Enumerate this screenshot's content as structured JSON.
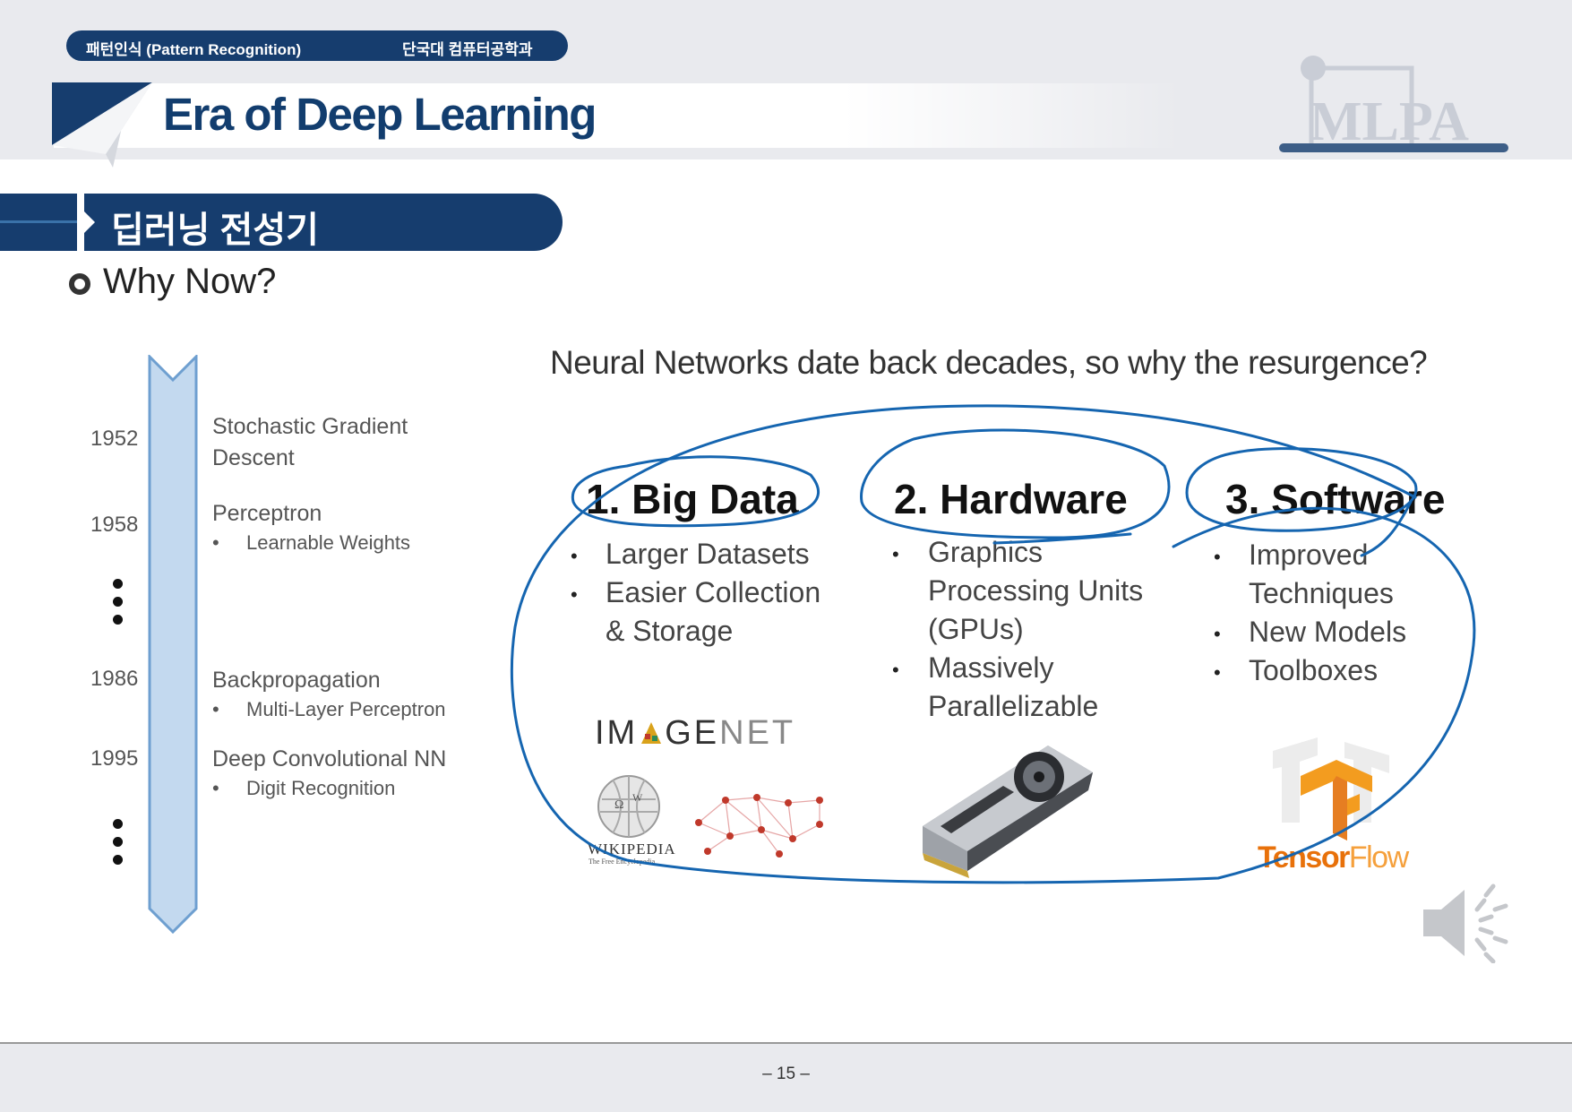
{
  "header": {
    "course": "패턴인식 (Pattern Recognition)",
    "department": "단국대 컴퓨터공학과",
    "title": "Era of Deep Learning",
    "logo_text": "MLPA"
  },
  "section": {
    "banner": "딥러닝 전성기",
    "bullet": "Why Now?"
  },
  "timeline": {
    "entries": [
      {
        "year": "1952",
        "title_line1": "Stochastic Gradient",
        "title_line2": "Descent",
        "sub": ""
      },
      {
        "year": "1958",
        "title_line1": "Perceptron",
        "title_line2": "",
        "sub": "Learnable Weights"
      },
      {
        "year": "1986",
        "title_line1": "Backpropagation",
        "title_line2": "",
        "sub": "Multi-Layer Perceptron"
      },
      {
        "year": "1995",
        "title_line1": "Deep Convolutional NN",
        "title_line2": "",
        "sub": "Digit Recognition"
      }
    ]
  },
  "panel": {
    "question": "Neural Networks date back decades, so why the resurgence?",
    "columns": [
      {
        "title": "1. Big Data",
        "items": [
          "Larger Datasets",
          "Easier Collection",
          "& Storage"
        ]
      },
      {
        "title": "2. Hardware",
        "items": [
          "Graphics",
          "Processing Units",
          "(GPUs)",
          "Massively",
          "Parallelizable"
        ]
      },
      {
        "title": "3. Software",
        "items": [
          "Improved",
          "Techniques",
          "New Models",
          "Toolboxes"
        ]
      }
    ],
    "logos": {
      "imagenet_a": "IM",
      "imagenet_b": "GE",
      "imagenet_c": "NET",
      "wikipedia": "WIKIPEDIA",
      "wikipedia_sub": "The Free Encyclopedia",
      "tensorflow_a": "Tensor",
      "tensorflow_b": "Flow"
    },
    "ink_color": "#1565b0"
  },
  "footer": {
    "page": "– 15 –"
  }
}
